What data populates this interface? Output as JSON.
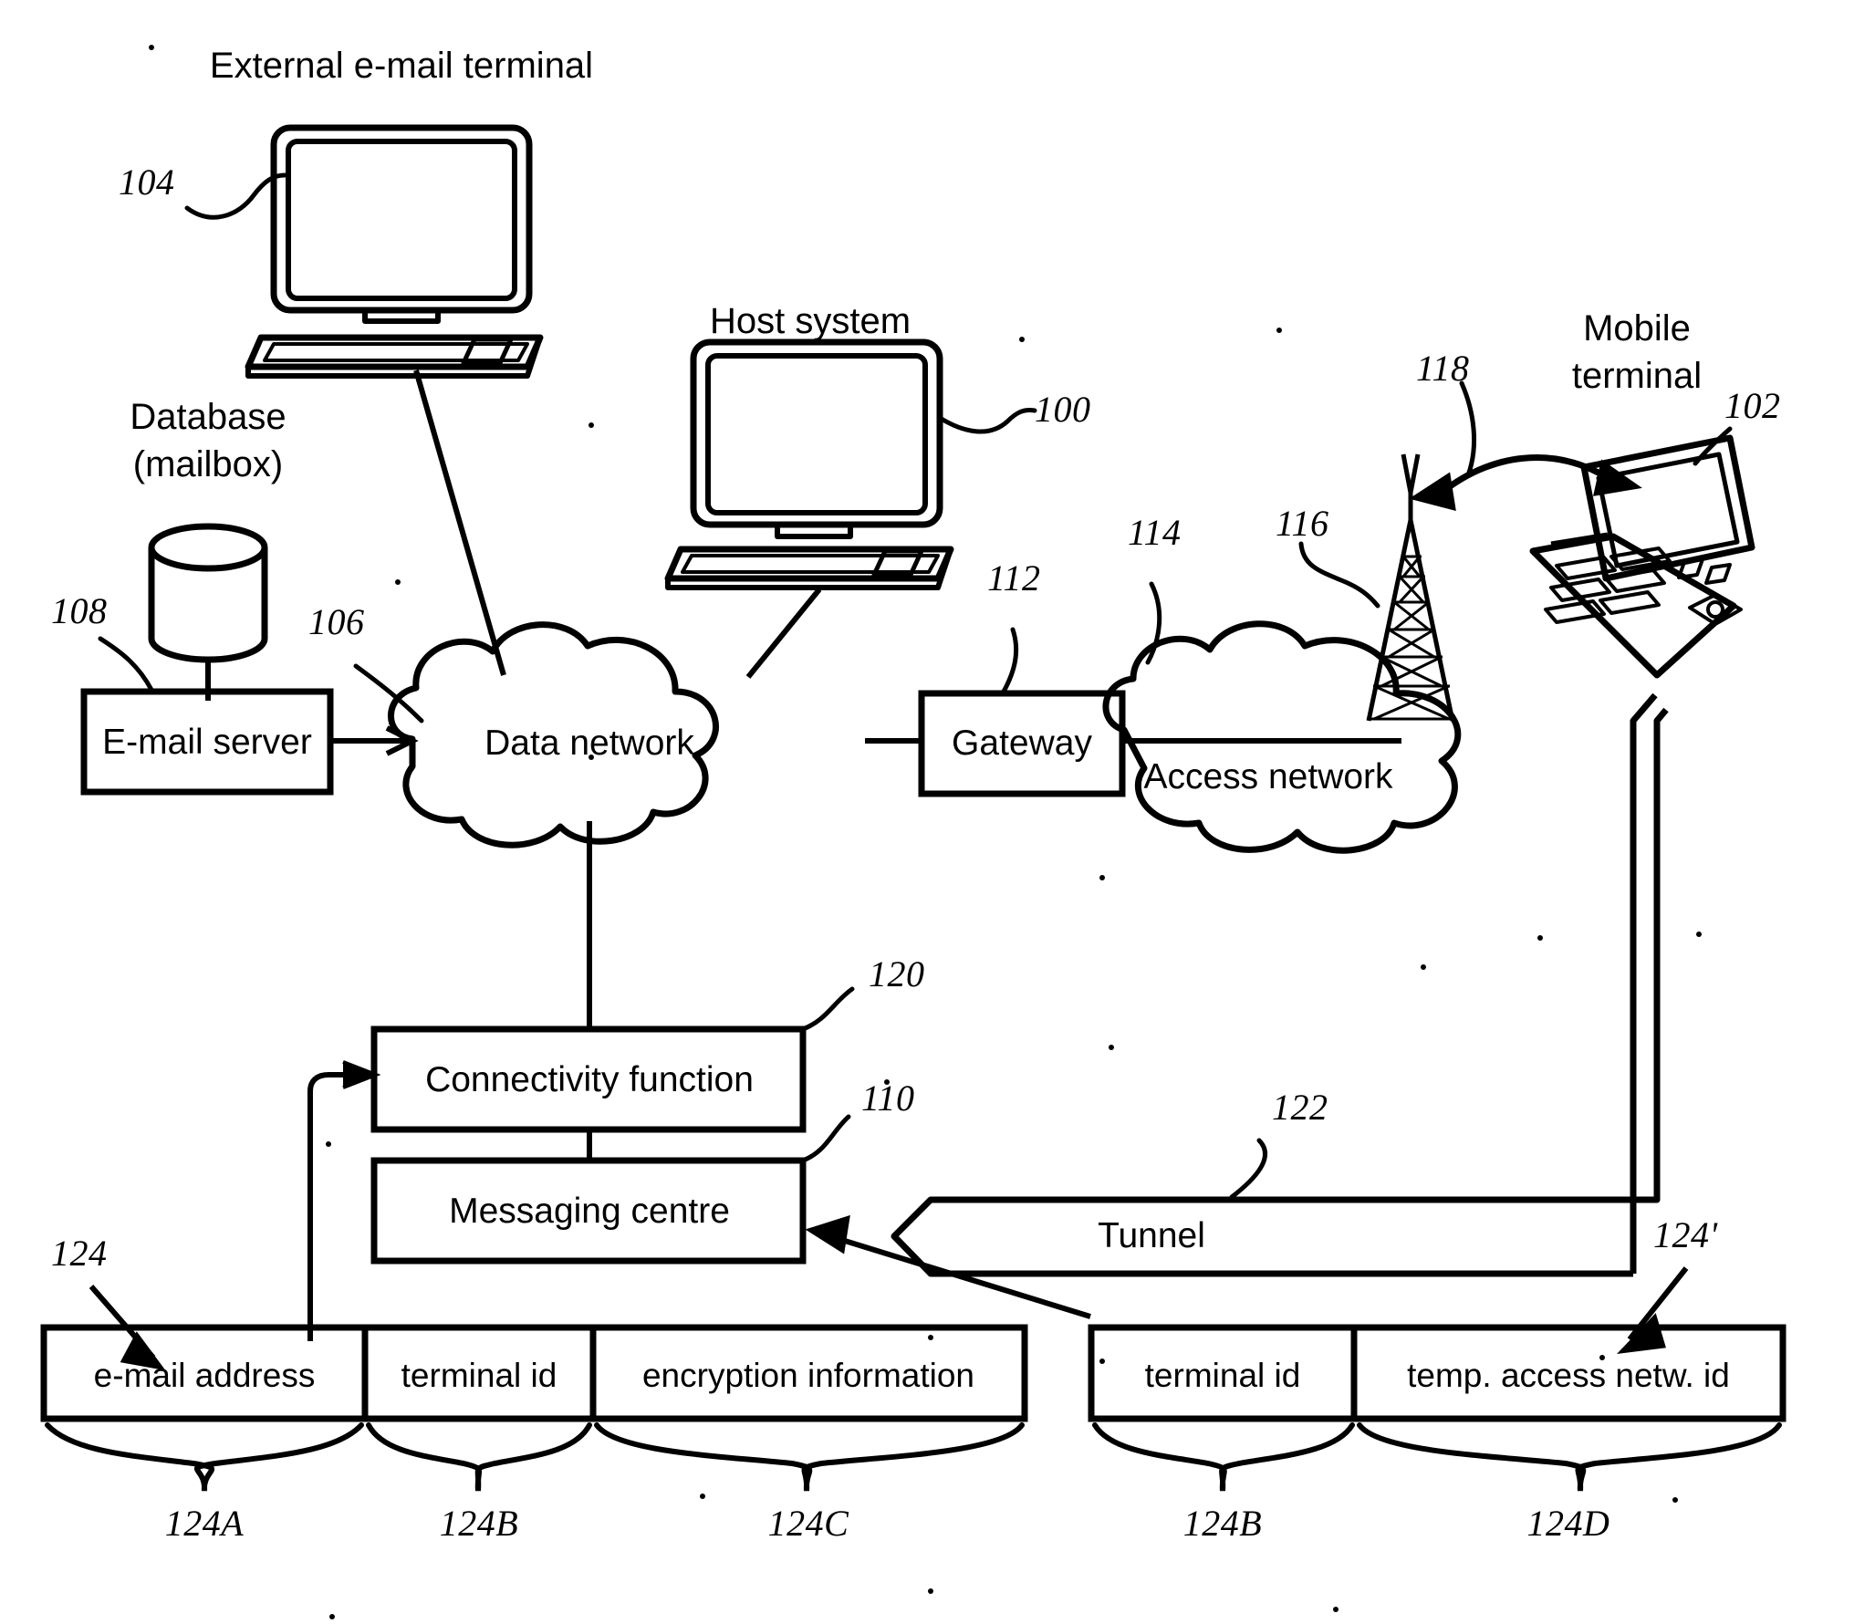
{
  "figure": {
    "domain_note": "patent network architecture diagram",
    "stroke_color": "#000000",
    "background_color": "#ffffff"
  },
  "nodes": {
    "external_email_terminal": {
      "label": "External e-mail terminal",
      "ref": "104",
      "icon": "desktop-computer-icon"
    },
    "database": {
      "label_line1": "Database",
      "label_line2": "(mailbox)",
      "ref": "108",
      "icon": "database-cylinder-icon"
    },
    "email_server": {
      "label": "E-mail server",
      "icon": "rectangle-box"
    },
    "data_network": {
      "label": "Data network",
      "ref": "106",
      "icon": "cloud-icon"
    },
    "host_system": {
      "label": "Host system",
      "ref": "100",
      "icon": "desktop-computer-icon"
    },
    "gateway": {
      "label": "Gateway",
      "ref": "112",
      "icon": "rectangle-box"
    },
    "access_network": {
      "label": "Access network",
      "ref": "114",
      "icon": "cloud-icon"
    },
    "base_station": {
      "ref": "116",
      "icon": "radio-tower-icon"
    },
    "radio_link": {
      "ref": "118",
      "icon": "double-headed-arc-arrow-icon"
    },
    "mobile_terminal": {
      "label_line1": "Mobile",
      "label_line2": "terminal",
      "ref": "102",
      "icon": "handheld-device-icon"
    },
    "connectivity_function": {
      "label": "Connectivity function",
      "ref": "120",
      "icon": "rectangle-box"
    },
    "messaging_centre": {
      "label": "Messaging centre",
      "ref": "110",
      "icon": "rectangle-box"
    },
    "tunnel": {
      "label": "Tunnel",
      "ref": "122",
      "icon": "left-arrow-block-icon"
    }
  },
  "record_left": {
    "ref": "124",
    "fields": [
      {
        "label": "e-mail address",
        "ref": "124A"
      },
      {
        "label": "terminal id",
        "ref": "124B"
      },
      {
        "label": "encryption information",
        "ref": "124C"
      }
    ]
  },
  "record_right": {
    "ref": "124'",
    "fields": [
      {
        "label": "terminal id",
        "ref": "124B"
      },
      {
        "label": "temp. access netw. id",
        "ref": "124D"
      }
    ]
  }
}
